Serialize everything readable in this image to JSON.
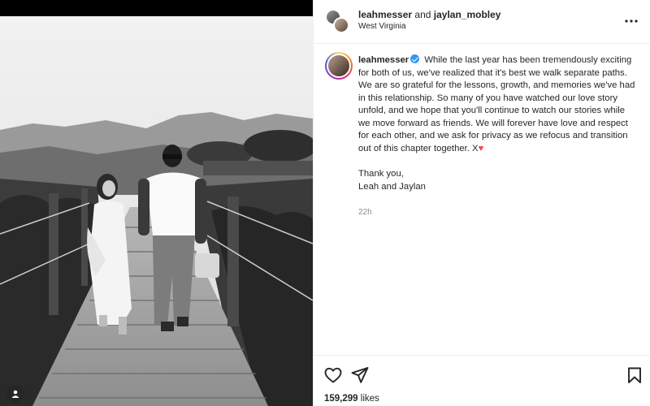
{
  "post": {
    "photo_description_icon": "couple-walking-boardwalk-photo",
    "user_tag_icon": "user-tag-icon"
  },
  "header": {
    "user1": "leahmesser",
    "conjunction": "and",
    "user2": "jaylan_mobley",
    "location": "West Virginia",
    "more_icon": "more-options-icon"
  },
  "caption": {
    "author": "leahmesser",
    "verified": true,
    "text": "While the last year has been tremendously exciting for both of us, we've realized that it's best we walk separate paths. We are so grateful for the lessons, growth, and memories we've had in this relationship. So many of you have watched our love story unfold, and we hope that you'll continue to watch our stories while we move forward as friends. We will forever have love and respect for each other, and we ask for privacy as we refocus and transition out of this chapter together. X",
    "emoji": "♥",
    "thanks": "Thank you,",
    "signature": "Leah and Jaylan",
    "time_ago": "22h"
  },
  "actions": {
    "like_icon": "heart-outline-icon",
    "share_icon": "paper-plane-icon",
    "save_icon": "bookmark-icon",
    "likes_count": "159,299",
    "likes_word": "likes"
  },
  "colors": {
    "text": "#262626",
    "muted": "#8e8e8e",
    "verified": "#3897f0",
    "heart": "#ed4956",
    "border": "#efefef"
  }
}
